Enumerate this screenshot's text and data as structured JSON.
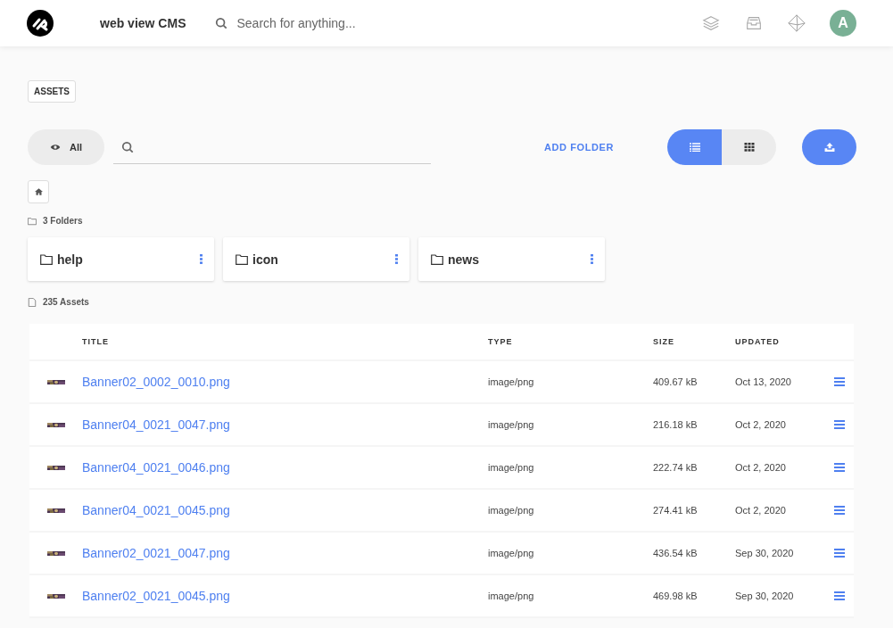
{
  "header": {
    "app_name": "web view CMS",
    "search": {
      "placeholder": "Search for anything..."
    },
    "avatar": "A"
  },
  "breadcrumb": "ASSETS",
  "toolbar": {
    "filter": "All",
    "add_folder": "ADD FOLDER",
    "view_modes": [
      {
        "kind": "list",
        "selected": true
      },
      {
        "kind": "grid",
        "selected": false
      }
    ]
  },
  "folders_count": "3 Folders",
  "folders": [
    {
      "name": "help"
    },
    {
      "name": "icon"
    },
    {
      "name": "news"
    }
  ],
  "assets_count": "235 Assets",
  "table": {
    "columns": [
      "TITLE",
      "TYPE",
      "SIZE",
      "UPDATED"
    ],
    "rows": [
      {
        "title": "Banner02_0002_0010.png",
        "type": "image/png",
        "size": "409.67 kB",
        "updated": "Oct 13, 2020"
      },
      {
        "title": "Banner04_0021_0047.png",
        "type": "image/png",
        "size": "216.18 kB",
        "updated": "Oct 2, 2020"
      },
      {
        "title": "Banner04_0021_0046.png",
        "type": "image/png",
        "size": "222.74 kB",
        "updated": "Oct 2, 2020"
      },
      {
        "title": "Banner04_0021_0045.png",
        "type": "image/png",
        "size": "274.41 kB",
        "updated": "Oct 2, 2020"
      },
      {
        "title": "Banner02_0021_0047.png",
        "type": "image/png",
        "size": "436.54 kB",
        "updated": "Sep 30, 2020"
      },
      {
        "title": "Banner02_0021_0045.png",
        "type": "image/png",
        "size": "469.98 kB",
        "updated": "Sep 30, 2020"
      }
    ]
  }
}
